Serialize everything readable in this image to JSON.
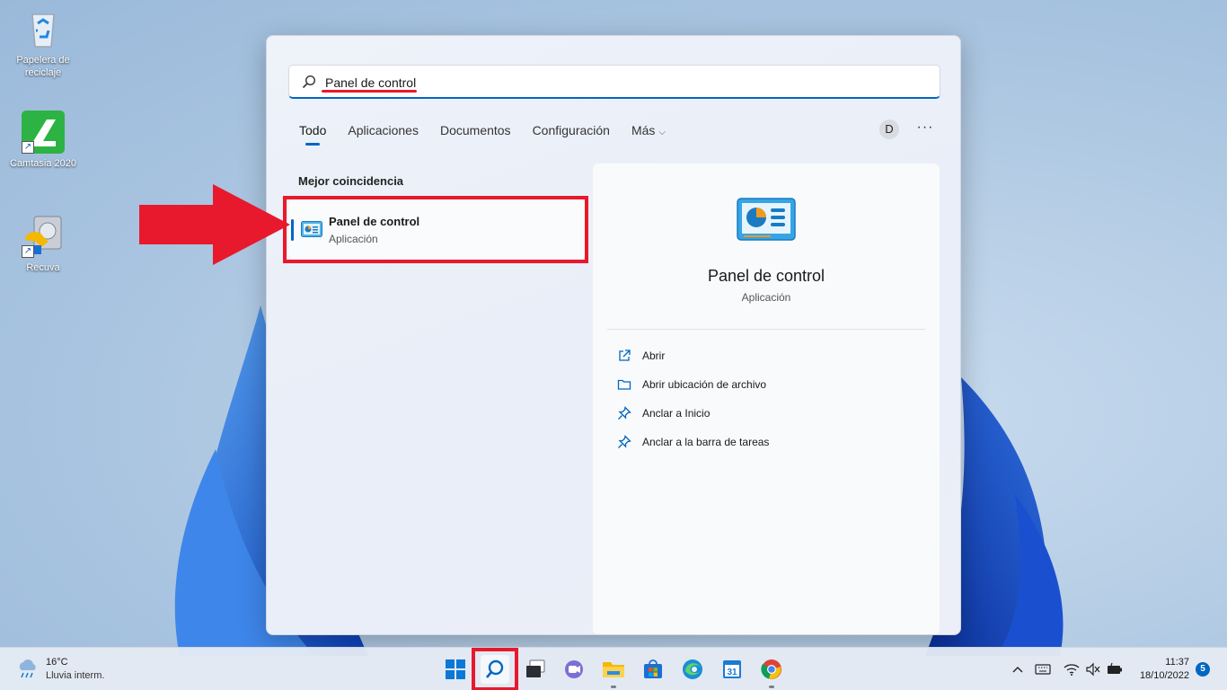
{
  "desktop": {
    "icons": [
      {
        "label": "Papelera de reciclaje",
        "icon": "recycle-bin-icon"
      },
      {
        "label": "Camtasia 2020",
        "icon": "camtasia-icon"
      },
      {
        "label": "Recuva",
        "icon": "recuva-icon"
      }
    ],
    "shortcut_glyph": "↗"
  },
  "search": {
    "query": "Panel de control",
    "tabs": [
      {
        "label": "Todo",
        "active": true
      },
      {
        "label": "Aplicaciones"
      },
      {
        "label": "Documentos"
      },
      {
        "label": "Configuración"
      },
      {
        "label": "Más"
      }
    ],
    "more_chevron": "⌵",
    "avatar_initial": "D",
    "overflow_label": "···",
    "best_match_title": "Mejor coincidencia",
    "best_match": {
      "name": "Panel de control",
      "type": "Aplicación"
    },
    "detail": {
      "name": "Panel de control",
      "type": "Aplicación",
      "actions": [
        {
          "label": "Abrir",
          "icon": "open-external-icon"
        },
        {
          "label": "Abrir ubicación de archivo",
          "icon": "folder-icon"
        },
        {
          "label": "Anclar a Inicio",
          "icon": "pin-icon"
        },
        {
          "label": "Anclar a la barra de tareas",
          "icon": "pin-icon"
        }
      ]
    }
  },
  "taskbar": {
    "weather": {
      "temp": "16°C",
      "condition": "Lluvia interm."
    },
    "clock": {
      "time": "11:37",
      "date": "18/10/2022"
    },
    "notification_count": "5",
    "calendar_day": "31"
  },
  "colors": {
    "accent": "#0067c0",
    "highlight_red": "#e8192c"
  }
}
